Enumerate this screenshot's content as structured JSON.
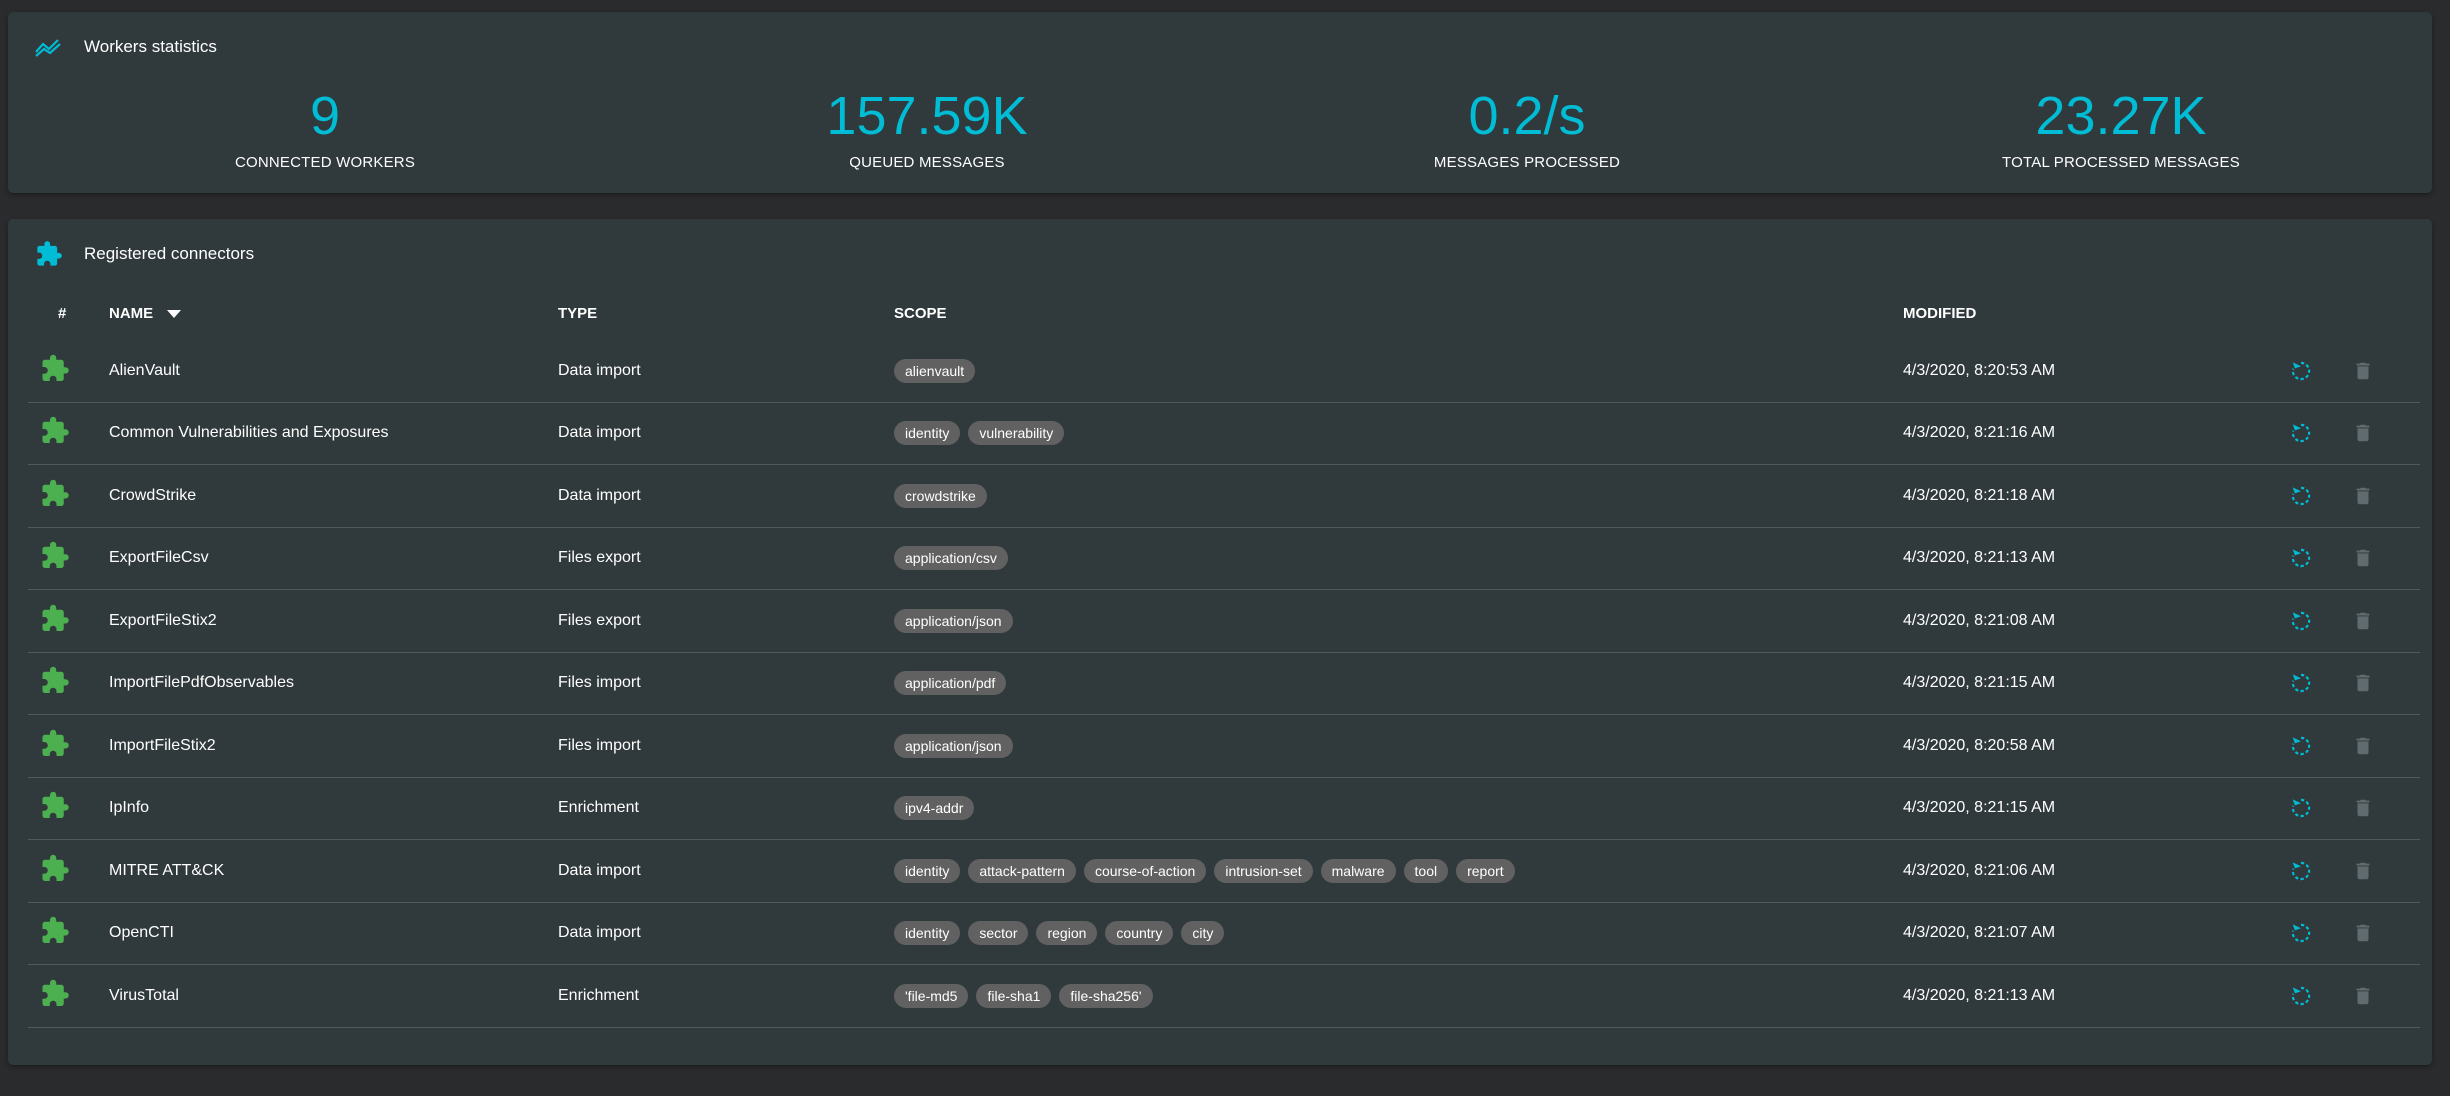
{
  "colors": {
    "accent": "#00bcd4",
    "connector_icon": "#4caf50",
    "chip_bg": "#616161",
    "disabled": "#5f6b6e"
  },
  "workers": {
    "title": "Workers statistics",
    "icon": "trend-chart-icon",
    "stats": [
      {
        "value": "9",
        "label": "CONNECTED WORKERS"
      },
      {
        "value": "157.59K",
        "label": "QUEUED MESSAGES"
      },
      {
        "value": "0.2/s",
        "label": "MESSAGES PROCESSED"
      },
      {
        "value": "23.27K",
        "label": "TOTAL PROCESSED MESSAGES"
      }
    ]
  },
  "connectors": {
    "title": "Registered connectors",
    "icon": "puzzle-icon",
    "headers": {
      "index": "#",
      "name": "NAME",
      "type": "TYPE",
      "scope": "SCOPE",
      "modified": "MODIFIED"
    },
    "sort": {
      "column": "name",
      "direction": "descending"
    },
    "rows": [
      {
        "name": "AlienVault",
        "type": "Data import",
        "scope": [
          "alienvault"
        ],
        "modified": "4/3/2020, 8:20:53 AM"
      },
      {
        "name": "Common Vulnerabilities and Exposures",
        "type": "Data import",
        "scope": [
          "identity",
          "vulnerability"
        ],
        "modified": "4/3/2020, 8:21:16 AM"
      },
      {
        "name": "CrowdStrike",
        "type": "Data import",
        "scope": [
          "crowdstrike"
        ],
        "modified": "4/3/2020, 8:21:18 AM"
      },
      {
        "name": "ExportFileCsv",
        "type": "Files export",
        "scope": [
          "application/csv"
        ],
        "modified": "4/3/2020, 8:21:13 AM"
      },
      {
        "name": "ExportFileStix2",
        "type": "Files export",
        "scope": [
          "application/json"
        ],
        "modified": "4/3/2020, 8:21:08 AM"
      },
      {
        "name": "ImportFilePdfObservables",
        "type": "Files import",
        "scope": [
          "application/pdf"
        ],
        "modified": "4/3/2020, 8:21:15 AM"
      },
      {
        "name": "ImportFileStix2",
        "type": "Files import",
        "scope": [
          "application/json"
        ],
        "modified": "4/3/2020, 8:20:58 AM"
      },
      {
        "name": "IpInfo",
        "type": "Enrichment",
        "scope": [
          "ipv4-addr"
        ],
        "modified": "4/3/2020, 8:21:15 AM"
      },
      {
        "name": "MITRE ATT&CK",
        "type": "Data import",
        "scope": [
          "identity",
          "attack-pattern",
          "course-of-action",
          "intrusion-set",
          "malware",
          "tool",
          "report"
        ],
        "modified": "4/3/2020, 8:21:06 AM"
      },
      {
        "name": "OpenCTI",
        "type": "Data import",
        "scope": [
          "identity",
          "sector",
          "region",
          "country",
          "city"
        ],
        "modified": "4/3/2020, 8:21:07 AM"
      },
      {
        "name": "VirusTotal",
        "type": "Enrichment",
        "scope": [
          "'file-md5",
          "file-sha1",
          "file-sha256'"
        ],
        "modified": "4/3/2020, 8:21:13 AM"
      }
    ]
  }
}
